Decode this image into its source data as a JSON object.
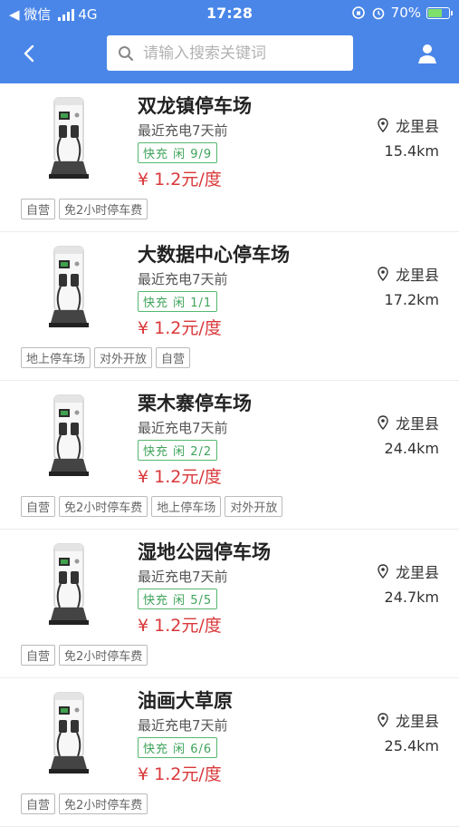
{
  "status_bar": {
    "carrier": "◀ 微信",
    "network": "4G",
    "time": "17:28",
    "battery": "70%",
    "battery_level": 0.7
  },
  "search": {
    "placeholder": "请输入搜索关键词"
  },
  "stations": [
    {
      "name": "双龙镇停车场",
      "recent": "最近充电7天前",
      "status": "快充 闲 9/9",
      "price": "¥ 1.2元/度",
      "region": "龙里县",
      "distance": "15.4km",
      "tags": [
        "自营",
        "免2小时停车费"
      ]
    },
    {
      "name": "大数据中心停车场",
      "recent": "最近充电7天前",
      "status": "快充 闲 1/1",
      "price": "¥ 1.2元/度",
      "region": "龙里县",
      "distance": "17.2km",
      "tags": [
        "地上停车场",
        "对外开放",
        "自营"
      ]
    },
    {
      "name": "栗木寨停车场",
      "recent": "最近充电7天前",
      "status": "快充 闲 2/2",
      "price": "¥ 1.2元/度",
      "region": "龙里县",
      "distance": "24.4km",
      "tags": [
        "自营",
        "免2小时停车费",
        "地上停车场",
        "对外开放"
      ]
    },
    {
      "name": "湿地公园停车场",
      "recent": "最近充电7天前",
      "status": "快充 闲 5/5",
      "price": "¥ 1.2元/度",
      "region": "龙里县",
      "distance": "24.7km",
      "tags": [
        "自营",
        "免2小时停车费"
      ]
    },
    {
      "name": "油画大草原",
      "recent": "最近充电7天前",
      "status": "快充 闲 6/6",
      "price": "¥ 1.2元/度",
      "region": "龙里县",
      "distance": "25.4km",
      "tags": [
        "自营",
        "免2小时停车费"
      ]
    }
  ]
}
